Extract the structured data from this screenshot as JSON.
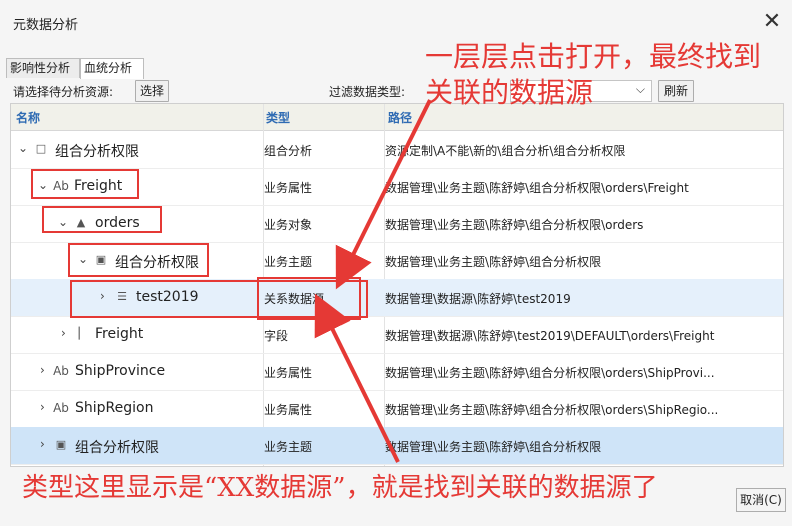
{
  "window": {
    "title": "元数据分析",
    "close_glyph": "✕"
  },
  "tabs": [
    {
      "label": "影响性分析",
      "active": false
    },
    {
      "label": "血统分析",
      "active": true
    }
  ],
  "toolbar": {
    "resource_label": "请选择待分析资源:",
    "select_button": "选择",
    "filter_label": "过滤数据类型:",
    "filter_value": "",
    "refresh_button": "刷新"
  },
  "grid": {
    "columns": [
      "名称",
      "类型",
      "路径"
    ],
    "rows": [
      {
        "name": "组合分析权限",
        "type": "组合分析",
        "path": "资源定制\\A不能\\新的\\组合分析\\组合分析权限",
        "icon": "combo-analysis-icon",
        "expanded": true
      },
      {
        "name": "Freight",
        "type": "业务属性",
        "path": "数据管理\\业务主题\\陈舒婷\\组合分析权限\\orders\\Freight",
        "icon": "business-attribute-icon",
        "expanded": true
      },
      {
        "name": "orders",
        "type": "业务对象",
        "path": "数据管理\\业务主题\\陈舒婷\\组合分析权限\\orders",
        "icon": "business-object-icon",
        "expanded": true
      },
      {
        "name": "组合分析权限",
        "type": "业务主题",
        "path": "数据管理\\业务主题\\陈舒婷\\组合分析权限",
        "icon": "business-topic-icon",
        "expanded": true
      },
      {
        "name": "test2019",
        "type": "关系数据源",
        "path": "数据管理\\数据源\\陈舒婷\\test2019",
        "icon": "datasource-icon",
        "expanded": false
      },
      {
        "name": "Freight",
        "type": "字段",
        "path": "数据管理\\数据源\\陈舒婷\\test2019\\DEFAULT\\orders\\Freight",
        "icon": "field-icon",
        "expanded": false
      },
      {
        "name": "ShipProvince",
        "type": "业务属性",
        "path": "数据管理\\业务主题\\陈舒婷\\组合分析权限\\orders\\ShipProvi...",
        "icon": "business-attribute-icon",
        "expanded": false
      },
      {
        "name": "ShipRegion",
        "type": "业务属性",
        "path": "数据管理\\业务主题\\陈舒婷\\组合分析权限\\orders\\ShipRegio...",
        "icon": "business-attribute-icon",
        "expanded": false
      },
      {
        "name": "组合分析权限",
        "type": "业务主题",
        "path": "数据管理\\业务主题\\陈舒婷\\组合分析权限",
        "icon": "business-topic-icon",
        "expanded": false
      }
    ]
  },
  "annotations": {
    "top_line1": "一层层点击打开，最终找到",
    "top_line2": "关联的数据源",
    "bottom": "类型这里显示是“XX数据源”，就是找到关联的数据源了",
    "color": "#e53935"
  },
  "footer": {
    "cancel_button": "取消(C)"
  }
}
